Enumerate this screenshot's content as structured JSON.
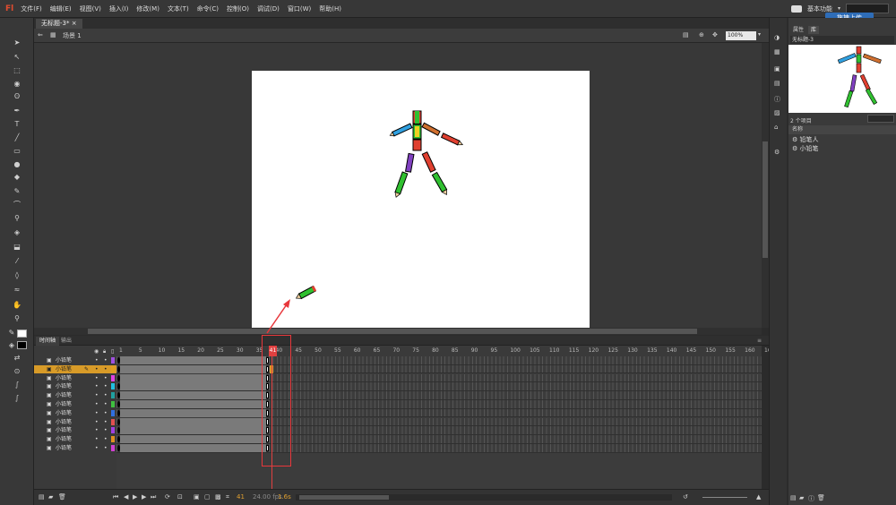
{
  "app": {
    "logo": "Fl"
  },
  "menu": [
    "文件(F)",
    "编辑(E)",
    "视图(V)",
    "插入(I)",
    "修改(M)",
    "文本(T)",
    "命令(C)",
    "控制(O)",
    "调试(D)",
    "窗口(W)",
    "帮助(H)"
  ],
  "workspace": "基本功能",
  "upload_button": "拖拽上传",
  "doc_tab": "无标题-3*",
  "scene": "场景 1",
  "zoom": "100%",
  "timeline": {
    "tabs": [
      "时间轴",
      "输出"
    ],
    "ruler": [
      "1",
      "5",
      "10",
      "15",
      "20",
      "25",
      "30",
      "35",
      "40",
      "45",
      "50",
      "55",
      "60",
      "65",
      "70",
      "75",
      "80",
      "85",
      "90",
      "95",
      "100",
      "105",
      "110",
      "115",
      "120",
      "125",
      "130",
      "135",
      "140",
      "145",
      "150",
      "155",
      "160",
      "16"
    ],
    "playhead_frame": "41",
    "layers": [
      "小铅笔",
      "小铅笔",
      "小铅笔",
      "小铅笔",
      "小铅笔",
      "小铅笔",
      "小铅笔",
      "小铅笔",
      "小铅笔",
      "小铅笔",
      "小铅笔"
    ],
    "selected_layer": 1,
    "layer_colors": [
      "#a050e0",
      "#e0a020",
      "#e040e0",
      "#20c0e0",
      "#20a0a0",
      "#40c040",
      "#3070e0",
      "#e05050",
      "#a040e0",
      "#e09020",
      "#d040d0"
    ],
    "footer_frame": "41",
    "footer_fps": "24.00 fps",
    "footer_time": "1.6s"
  },
  "library": {
    "tabs": [
      "属性",
      "库"
    ],
    "document": "无标题-3",
    "count": "2 个项目",
    "name_header": "名称",
    "items": [
      "铅笔人",
      "小铅笔"
    ]
  },
  "colors": {
    "annotation": "#e8373b",
    "selected_layer": "#d89b28"
  }
}
